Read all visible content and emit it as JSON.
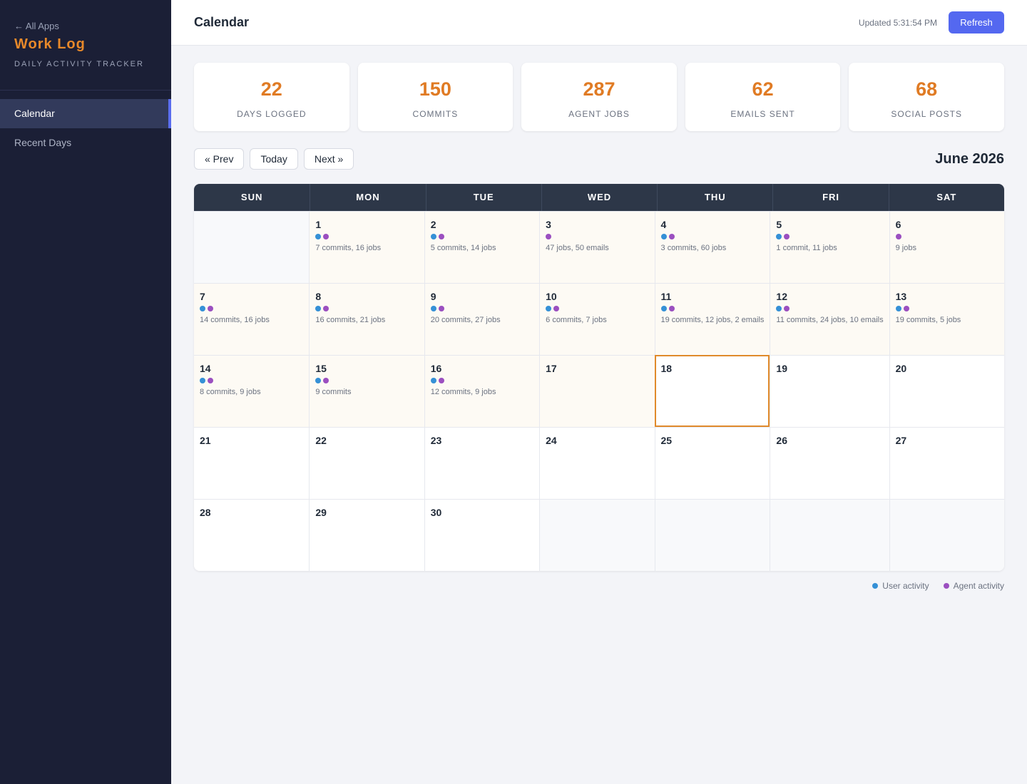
{
  "sidebar": {
    "back_link": "← All Apps",
    "brand": "Work Log",
    "tagline": "DAILY ACTIVITY TRACKER",
    "items": [
      {
        "label": "Calendar",
        "active": true
      },
      {
        "label": "Recent Days",
        "active": false
      }
    ]
  },
  "header": {
    "title": "Calendar",
    "updated": "Updated 5:31:54 PM",
    "refresh_label": "Refresh"
  },
  "stats": [
    {
      "value": "22",
      "label": "DAYS LOGGED"
    },
    {
      "value": "150",
      "label": "COMMITS"
    },
    {
      "value": "287",
      "label": "AGENT JOBS"
    },
    {
      "value": "62",
      "label": "EMAILS SENT"
    },
    {
      "value": "68",
      "label": "SOCIAL POSTS"
    }
  ],
  "calendar_nav": {
    "prev_label": "« Prev",
    "today_label": "Today",
    "next_label": "Next »",
    "month_title": "June 2026"
  },
  "calendar": {
    "weekdays": [
      "SUN",
      "MON",
      "TUE",
      "WED",
      "THU",
      "FRI",
      "SAT"
    ],
    "today": 18,
    "days": [
      null,
      {
        "day": "1",
        "user": true,
        "agent": true,
        "summary": "7 commits, 16 jobs"
      },
      {
        "day": "2",
        "user": true,
        "agent": true,
        "summary": "5 commits, 14 jobs"
      },
      {
        "day": "3",
        "user": false,
        "agent": true,
        "summary": "47 jobs, 50 emails"
      },
      {
        "day": "4",
        "user": true,
        "agent": true,
        "summary": "3 commits, 60 jobs"
      },
      {
        "day": "5",
        "user": true,
        "agent": true,
        "summary": "1 commit, 11 jobs"
      },
      {
        "day": "6",
        "user": false,
        "agent": true,
        "summary": "9 jobs"
      },
      {
        "day": "7",
        "user": true,
        "agent": true,
        "summary": "14 commits, 16 jobs"
      },
      {
        "day": "8",
        "user": true,
        "agent": true,
        "summary": "16 commits, 21 jobs"
      },
      {
        "day": "9",
        "user": true,
        "agent": true,
        "summary": "20 commits, 27 jobs"
      },
      {
        "day": "10",
        "user": true,
        "agent": true,
        "summary": "6 commits, 7 jobs"
      },
      {
        "day": "11",
        "user": true,
        "agent": true,
        "summary": "19 commits, 12 jobs, 2 emails"
      },
      {
        "day": "12",
        "user": true,
        "agent": true,
        "summary": "11 commits, 24 jobs, 10 emails"
      },
      {
        "day": "13",
        "user": true,
        "agent": true,
        "summary": "19 commits, 5 jobs"
      },
      {
        "day": "14",
        "user": true,
        "agent": true,
        "summary": "8 commits, 9 jobs"
      },
      {
        "day": "15",
        "user": true,
        "agent": true,
        "summary": "9 commits"
      },
      {
        "day": "16",
        "user": true,
        "agent": true,
        "summary": "12 commits, 9 jobs"
      },
      {
        "day": "17",
        "user": false,
        "agent": false,
        "summary": "",
        "logged": true
      },
      {
        "day": "18",
        "user": false,
        "agent": false,
        "summary": ""
      },
      {
        "day": "19",
        "user": false,
        "agent": false,
        "summary": ""
      },
      {
        "day": "20",
        "user": false,
        "agent": false,
        "summary": ""
      },
      {
        "day": "21",
        "user": false,
        "agent": false,
        "summary": ""
      },
      {
        "day": "22",
        "user": false,
        "agent": false,
        "summary": ""
      },
      {
        "day": "23",
        "user": false,
        "agent": false,
        "summary": ""
      },
      {
        "day": "24",
        "user": false,
        "agent": false,
        "summary": ""
      },
      {
        "day": "25",
        "user": false,
        "agent": false,
        "summary": ""
      },
      {
        "day": "26",
        "user": false,
        "agent": false,
        "summary": ""
      },
      {
        "day": "27",
        "user": false,
        "agent": false,
        "summary": ""
      },
      {
        "day": "28",
        "user": false,
        "agent": false,
        "summary": ""
      },
      {
        "day": "29",
        "user": false,
        "agent": false,
        "summary": ""
      },
      {
        "day": "30",
        "user": false,
        "agent": false,
        "summary": ""
      },
      null,
      null,
      null,
      null
    ]
  },
  "legend": {
    "user_label": "User activity",
    "agent_label": "Agent activity"
  },
  "colors": {
    "accent": "#e07b24",
    "primary": "#5468f0",
    "user_dot": "#3590d6",
    "agent_dot": "#9b4fc0",
    "sidebar_bg": "#1b1f36"
  }
}
